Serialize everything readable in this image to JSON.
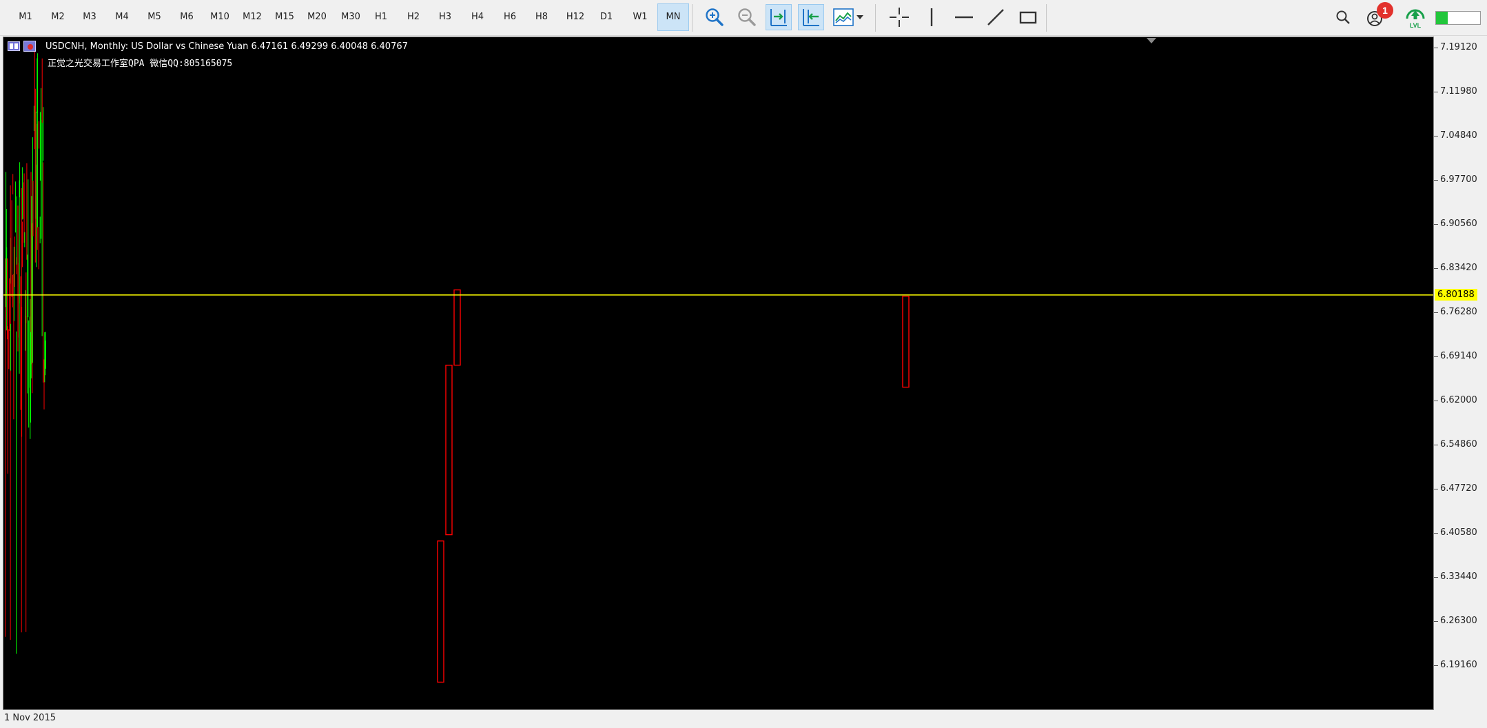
{
  "toolbar": {
    "timeframes": [
      "M1",
      "M2",
      "M3",
      "M4",
      "M5",
      "M6",
      "M10",
      "M12",
      "M15",
      "M20",
      "M30",
      "H1",
      "H2",
      "H3",
      "H4",
      "H6",
      "H8",
      "H12",
      "D1",
      "W1",
      "MN"
    ],
    "active_timeframe": "MN",
    "notification_count": "1",
    "lvl_label": "LVL"
  },
  "chart": {
    "title": "USDCNH, Monthly:  US Dollar vs Chinese Yuan  6.47161 6.49299 6.40048 6.40767",
    "watermark": "正觉之光交易工作室QPA 微信QQ:805165075",
    "current_price": "6.80188",
    "date_label": "1 Nov 2015",
    "price_scale": [
      "7.19120",
      "7.11980",
      "7.04840",
      "6.97700",
      "6.90560",
      "6.83420",
      "6.76280",
      "6.69140",
      "6.62000",
      "6.54860",
      "6.47720",
      "6.40580",
      "6.33440",
      "6.26300",
      "6.19160"
    ],
    "colors": {
      "background": "#000000",
      "bull": "#00ff00",
      "bear": "#ff0000",
      "price_line": "#ffff00"
    }
  },
  "chart_data": {
    "type": "candlestick",
    "ylim": [
      6.1416,
      7.2126
    ],
    "current_price": 6.80188,
    "boxes": [
      {
        "open": 6.41,
        "close": 6.185
      },
      {
        "open": 6.69,
        "close": 6.42
      },
      {
        "open": 6.81,
        "close": 6.69
      },
      {
        "open": 6.8,
        "close": 6.655
      }
    ]
  }
}
